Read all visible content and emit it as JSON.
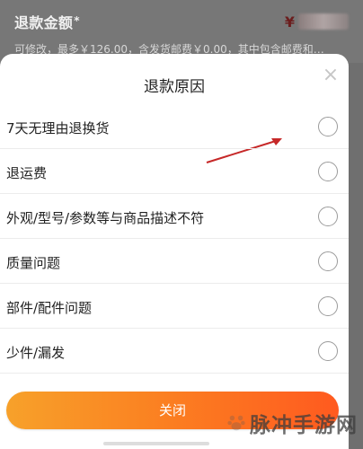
{
  "background": {
    "title": "退款金额",
    "required_mark": "*",
    "currency_symbol": "¥",
    "description": "可修改，最多￥126.00，含发货邮费￥0.00，其中包含邮费和…"
  },
  "sheet": {
    "title": "退款原因",
    "close_icon": "close-icon",
    "reasons": [
      "7天无理由退换货",
      "退运费",
      "外观/型号/参数等与商品描述不符",
      "质量问题",
      "部件/配件问题",
      "少件/漏发"
    ],
    "close_button": "关闭"
  },
  "annotation": {
    "arrow_color": "#c62828"
  },
  "watermark": {
    "text": "脉冲手游网"
  },
  "colors": {
    "button_gradient_start": "#f7a12a",
    "button_gradient_end": "#ff5a1f",
    "currency_color": "#6b1d1d"
  }
}
